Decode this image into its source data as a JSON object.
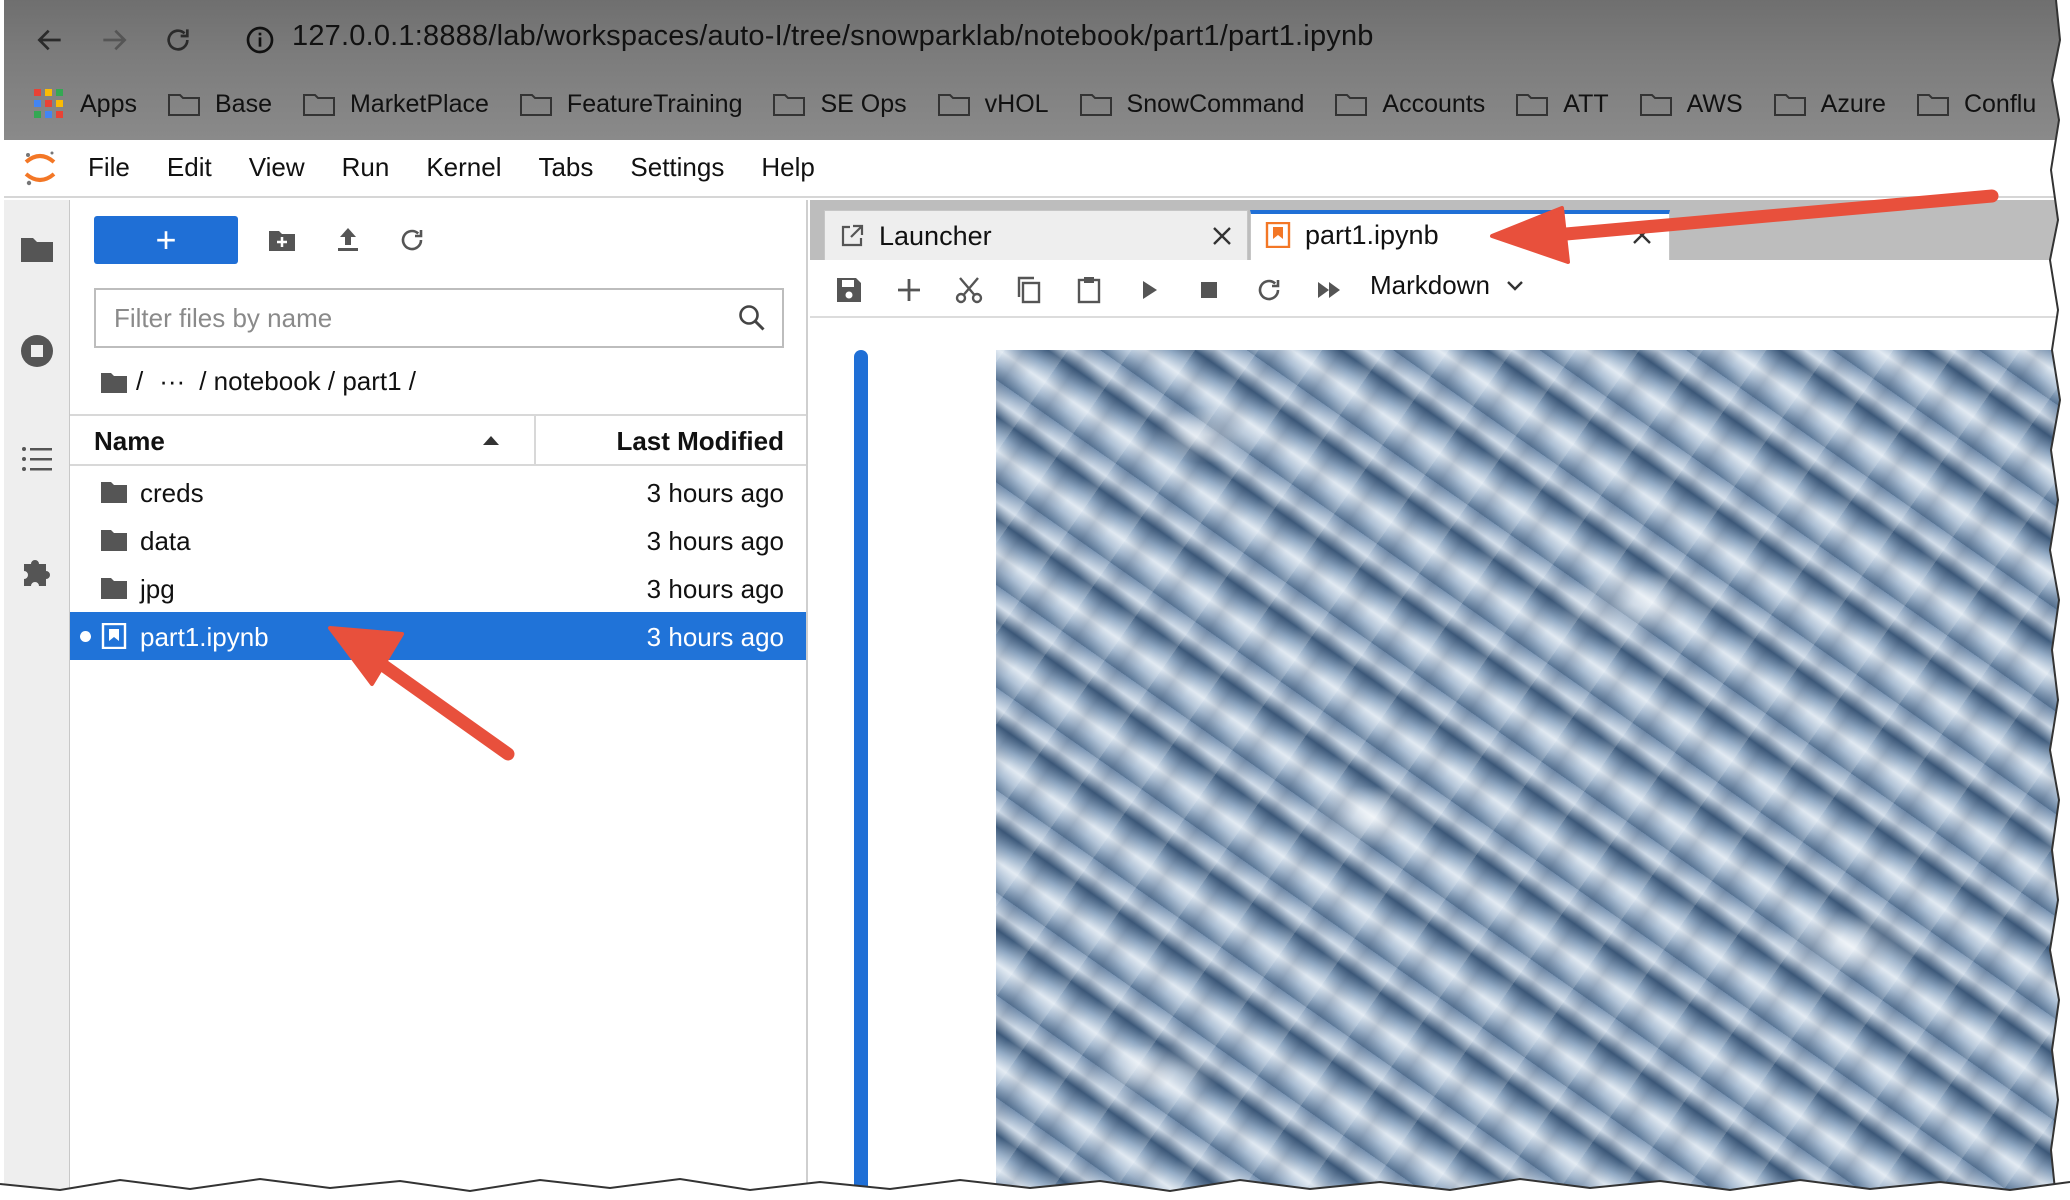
{
  "browser": {
    "url": "127.0.0.1:8888/lab/workspaces/auto-I/tree/snowparklab/notebook/part1/part1.ipynb",
    "bookmarks": [
      {
        "label": "Apps",
        "icon": "apps-grid-icon"
      },
      {
        "label": "Base",
        "icon": "folder-icon"
      },
      {
        "label": "MarketPlace",
        "icon": "folder-icon"
      },
      {
        "label": "FeatureTraining",
        "icon": "folder-icon"
      },
      {
        "label": "SE Ops",
        "icon": "folder-icon"
      },
      {
        "label": "vHOL",
        "icon": "folder-icon"
      },
      {
        "label": "SnowCommand",
        "icon": "folder-icon"
      },
      {
        "label": "Accounts",
        "icon": "folder-icon"
      },
      {
        "label": "ATT",
        "icon": "folder-icon"
      },
      {
        "label": "AWS",
        "icon": "folder-icon"
      },
      {
        "label": "Azure",
        "icon": "folder-icon"
      },
      {
        "label": "Conflu",
        "icon": "folder-icon"
      }
    ]
  },
  "menubar": {
    "items": [
      "File",
      "Edit",
      "View",
      "Run",
      "Kernel",
      "Tabs",
      "Settings",
      "Help"
    ]
  },
  "filebrowser": {
    "new_label": "+",
    "filter_placeholder": "Filter files by name",
    "breadcrumb": {
      "root": "/",
      "ellipsis": "···",
      "path": "/ notebook / part1 /"
    },
    "columns": {
      "name": "Name",
      "modified": "Last Modified"
    },
    "rows": [
      {
        "name": "creds",
        "modified": "3 hours ago",
        "type": "folder",
        "selected": false
      },
      {
        "name": "data",
        "modified": "3 hours ago",
        "type": "folder",
        "selected": false
      },
      {
        "name": "jpg",
        "modified": "3 hours ago",
        "type": "folder",
        "selected": false
      },
      {
        "name": "part1.ipynb",
        "modified": "3 hours ago",
        "type": "notebook",
        "selected": true
      }
    ]
  },
  "tabs": [
    {
      "label": "Launcher",
      "active": false
    },
    {
      "label": "part1.ipynb",
      "active": true
    }
  ],
  "notebook_toolbar": {
    "cell_type": "Markdown"
  },
  "colors": {
    "accent": "#1f6fd6",
    "selection": "#2073d8",
    "annotation_arrow": "#e8503c",
    "notebook_icon": "#f37726"
  }
}
